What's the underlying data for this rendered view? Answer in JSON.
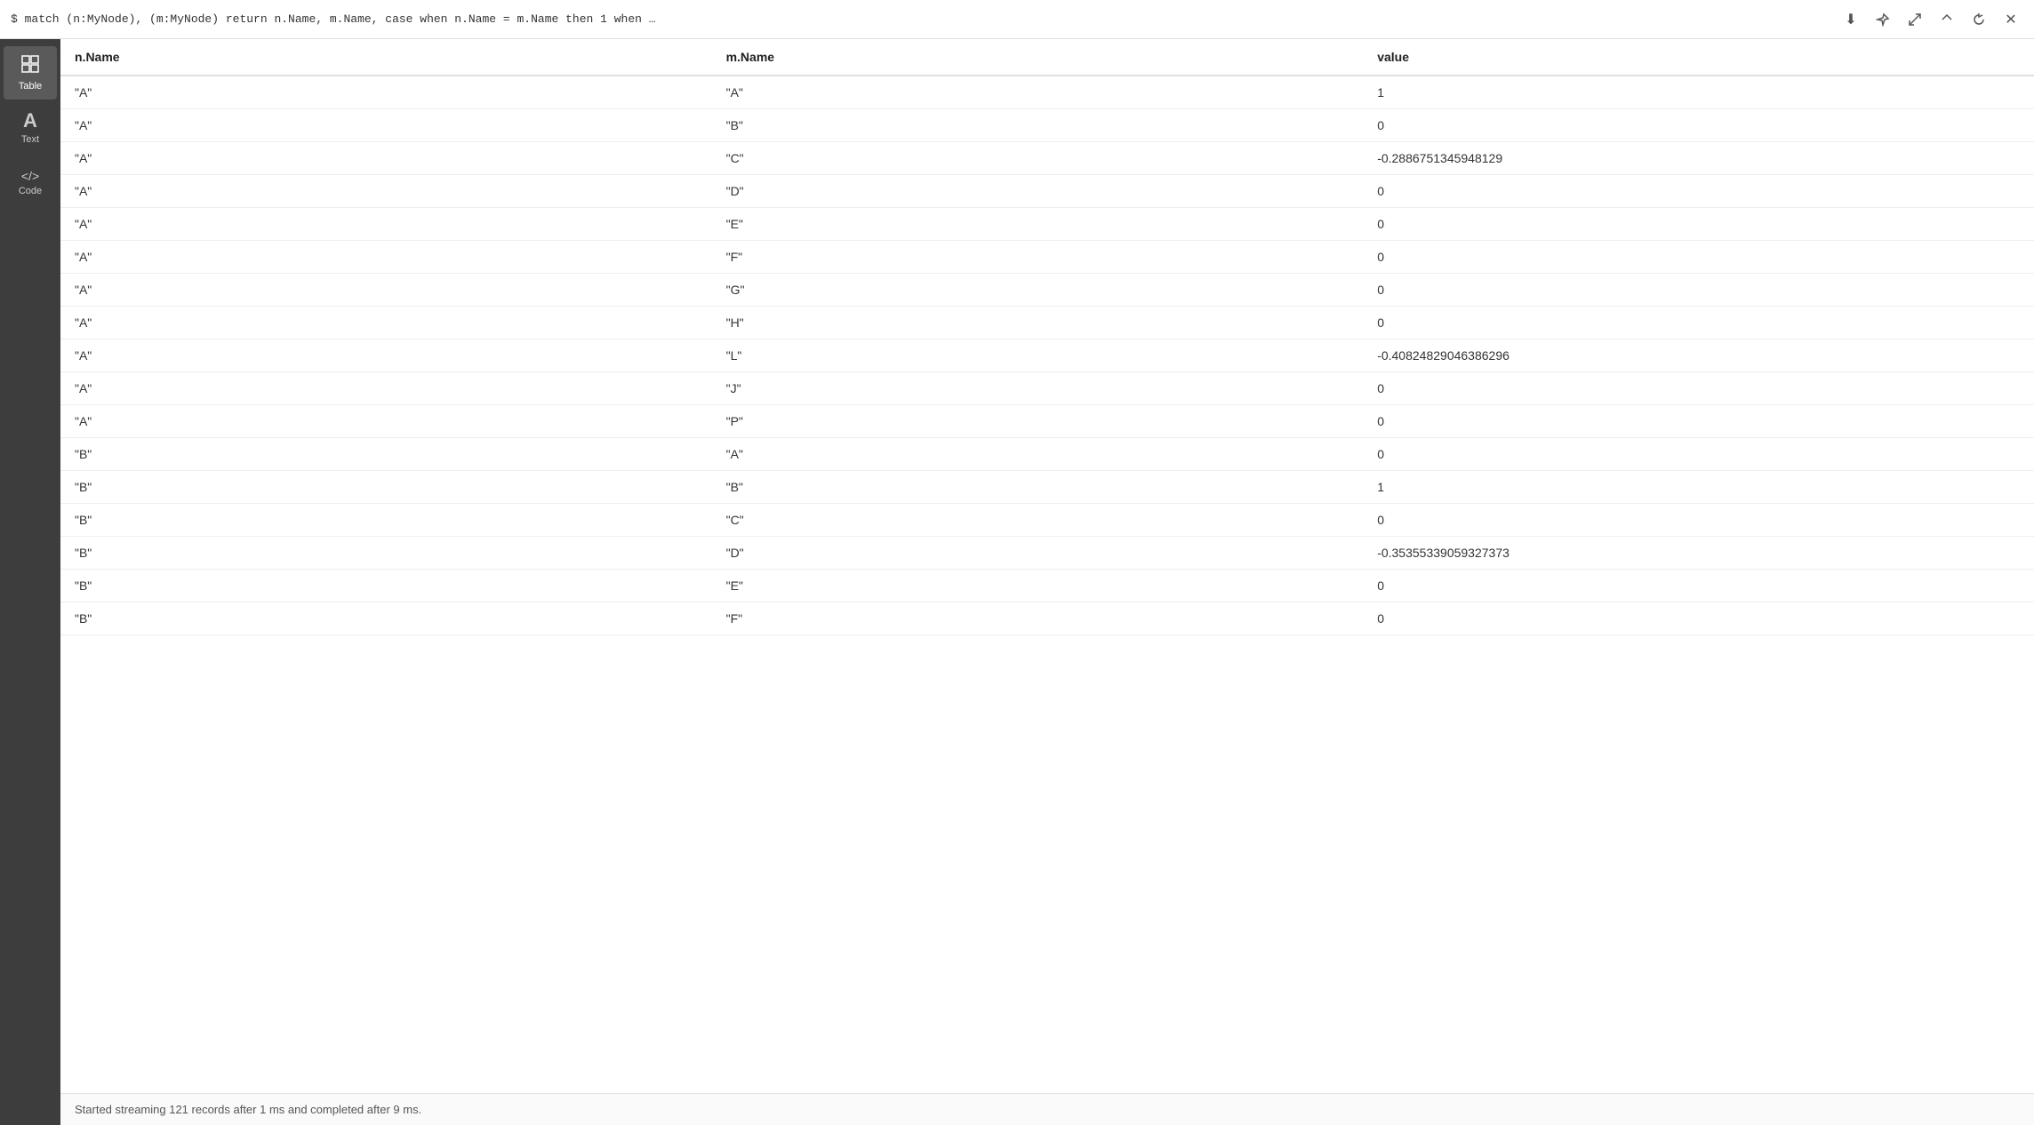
{
  "topbar": {
    "query": "$ match (n:MyNode), (m:MyNode) return n.Name, m.Name, case when n.Name = m.Name then 1 when …"
  },
  "actions": {
    "download": "⬇",
    "pin": "📌",
    "expand": "↗",
    "collapse": "∧",
    "refresh": "↺",
    "close": "✕"
  },
  "sidebar": {
    "items": [
      {
        "id": "table",
        "label": "Table",
        "icon": "⊞",
        "active": true
      },
      {
        "id": "text",
        "label": "Text",
        "icon": "A",
        "active": false
      },
      {
        "id": "code",
        "label": "Code",
        "icon": "</>",
        "active": false
      }
    ]
  },
  "table": {
    "columns": [
      "n.Name",
      "m.Name",
      "value"
    ],
    "rows": [
      {
        "nName": "\"A\"",
        "mName": "\"A\"",
        "value": "1"
      },
      {
        "nName": "\"A\"",
        "mName": "\"B\"",
        "value": "0"
      },
      {
        "nName": "\"A\"",
        "mName": "\"C\"",
        "value": "-0.2886751345948129"
      },
      {
        "nName": "\"A\"",
        "mName": "\"D\"",
        "value": "0"
      },
      {
        "nName": "\"A\"",
        "mName": "\"E\"",
        "value": "0"
      },
      {
        "nName": "\"A\"",
        "mName": "\"F\"",
        "value": "0"
      },
      {
        "nName": "\"A\"",
        "mName": "\"G\"",
        "value": "0"
      },
      {
        "nName": "\"A\"",
        "mName": "\"H\"",
        "value": "0"
      },
      {
        "nName": "\"A\"",
        "mName": "\"L\"",
        "value": "-0.40824829046386296"
      },
      {
        "nName": "\"A\"",
        "mName": "\"J\"",
        "value": "0"
      },
      {
        "nName": "\"A\"",
        "mName": "\"P\"",
        "value": "0"
      },
      {
        "nName": "\"B\"",
        "mName": "\"A\"",
        "value": "0"
      },
      {
        "nName": "\"B\"",
        "mName": "\"B\"",
        "value": "1"
      },
      {
        "nName": "\"B\"",
        "mName": "\"C\"",
        "value": "0"
      },
      {
        "nName": "\"B\"",
        "mName": "\"D\"",
        "value": "-0.35355339059327373"
      },
      {
        "nName": "\"B\"",
        "mName": "\"E\"",
        "value": "0"
      },
      {
        "nName": "\"B\"",
        "mName": "\"F\"",
        "value": "0"
      }
    ]
  },
  "statusBar": {
    "message": "Started streaming 121 records after 1 ms and completed after 9 ms."
  }
}
